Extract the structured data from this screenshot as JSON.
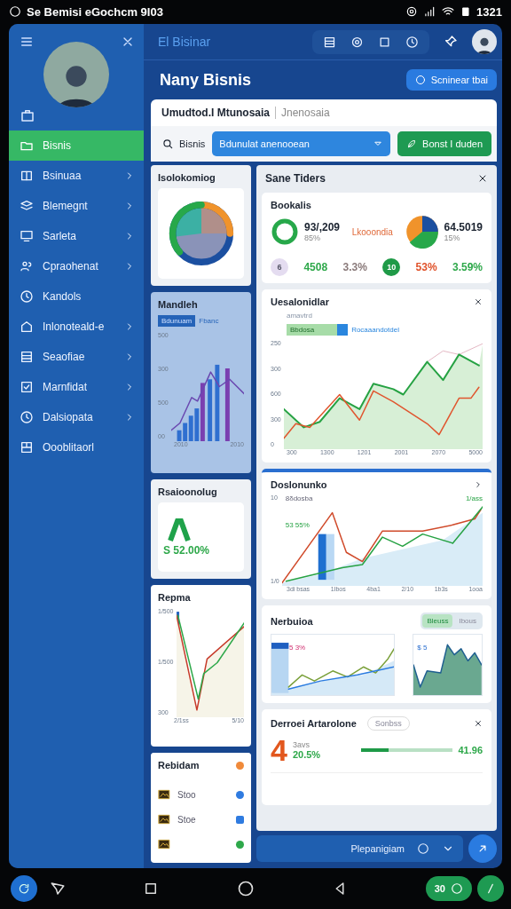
{
  "status_bar": {
    "title": "Se Bemisi eGochcm 9I03",
    "time": "1321"
  },
  "sidebar": {
    "items": [
      {
        "label": "Bisnis",
        "selected": true,
        "has_submenu": false
      },
      {
        "label": "Bsinuaa",
        "selected": false,
        "has_submenu": true
      },
      {
        "label": "Blemegnt",
        "selected": false,
        "has_submenu": true
      },
      {
        "label": "Sarleta",
        "selected": false,
        "has_submenu": true
      },
      {
        "label": "Cpraohenat",
        "selected": false,
        "has_submenu": true
      },
      {
        "label": "Kandols",
        "selected": false,
        "has_submenu": false
      },
      {
        "label": "Inlonoteald-e",
        "selected": false,
        "has_submenu": true
      },
      {
        "label": "Seaofiae",
        "selected": false,
        "has_submenu": true
      },
      {
        "label": "Marnfidat",
        "selected": false,
        "has_submenu": true
      },
      {
        "label": "Dalsiopata",
        "selected": false,
        "has_submenu": true
      },
      {
        "label": "Oooblitaorl",
        "selected": false,
        "has_submenu": false
      }
    ]
  },
  "topbar": {
    "title": "El Bisinar"
  },
  "header": {
    "title": "Nany Bisnis",
    "button": "Scninear tbai"
  },
  "search": {
    "value": "Umudtod.I Mtunosaia",
    "placeholder": "Jnenosaia"
  },
  "filters": {
    "label": "Bisnis",
    "dropdown": "Bdunulat anenooean",
    "button": "Bonst I duden"
  },
  "left_cards": [
    {
      "kind": "pie",
      "title": "Isolokomiog"
    },
    {
      "kind": "bars",
      "title": "Mandleh",
      "legend": [
        "Bdunuam",
        "Fbanc"
      ],
      "y_labels": [
        "500",
        "300",
        "500",
        "00"
      ],
      "x_labels": [
        "2010",
        "2010"
      ]
    },
    {
      "kind": "stat",
      "title": "Rsaioonolug",
      "value": "S 52.00%"
    },
    {
      "kind": "line",
      "title": "Repma",
      "y_labels": [
        "1/500",
        "1/500",
        "300"
      ],
      "x_labels": [
        "2/1ss",
        "5/10"
      ]
    },
    {
      "kind": "list",
      "title": "Rebidam",
      "color": "#f08a3a",
      "rows": [
        {
          "label": "Stoo",
          "color": "#2f7be0"
        },
        {
          "label": "Stoe",
          "color": "#2f7be0"
        },
        {
          "color": "#2ea84a"
        }
      ]
    }
  ],
  "panel": {
    "title": "Sane Tiders",
    "cards": [
      {
        "kind": "summary",
        "title": "Bookalis",
        "left_value": "93/,209",
        "left_sub": "85%",
        "middle": "Lkooondia",
        "right_value": "64.5019",
        "right_sub": "15%",
        "stats": [
          {
            "text": "6",
            "badge": true,
            "color": "#e4dcf0"
          },
          {
            "text": "4508",
            "color": "#2ea84a"
          },
          {
            "text": "3.3%",
            "color": "#8a7a7a"
          },
          {
            "text": "10",
            "badge": true,
            "color": "#1f9a47"
          },
          {
            "text": "53%",
            "color": "#e0522a"
          },
          {
            "text": "3.59%",
            "color": "#2ea84a"
          }
        ]
      },
      {
        "kind": "area",
        "title": "Uesalonidlar",
        "caption": "amavtrd",
        "legend": [
          "Bbdosa",
          "Rocaaandotdel"
        ],
        "y_labels": [
          "250",
          "300",
          "600",
          "300",
          "0"
        ],
        "x_labels": [
          "300",
          "1300",
          "1201",
          "2001",
          "2070",
          "5000"
        ]
      },
      {
        "kind": "multi",
        "title": "Doslonunko",
        "highlighted": true,
        "legend": [
          "8δdosba",
          "53 55%"
        ],
        "peak": "1/ass",
        "y_labels": [
          "10",
          "1/0"
        ],
        "x_labels": [
          "3di bsas",
          "1Ibos",
          "4ba1",
          "2/10",
          "1b3s",
          "1ooa"
        ]
      },
      {
        "kind": "pair",
        "title": "Nerbuioa",
        "toggle": [
          {
            "label": "Bleuss",
            "selected": true
          },
          {
            "label": "Ibous",
            "selected": false
          }
        ],
        "left_label": "5 3%",
        "right_label": "$ 5"
      },
      {
        "kind": "progress",
        "title": "Derroei Artarolone",
        "chip": "Sonbss",
        "big": "4",
        "sub": "3avs",
        "value": "20.5%",
        "level": 0.3,
        "reading": "41.96"
      }
    ]
  },
  "bottom_bar": {
    "label": "Plepanigiam"
  },
  "nav_bar": {
    "pill_text": "30"
  }
}
